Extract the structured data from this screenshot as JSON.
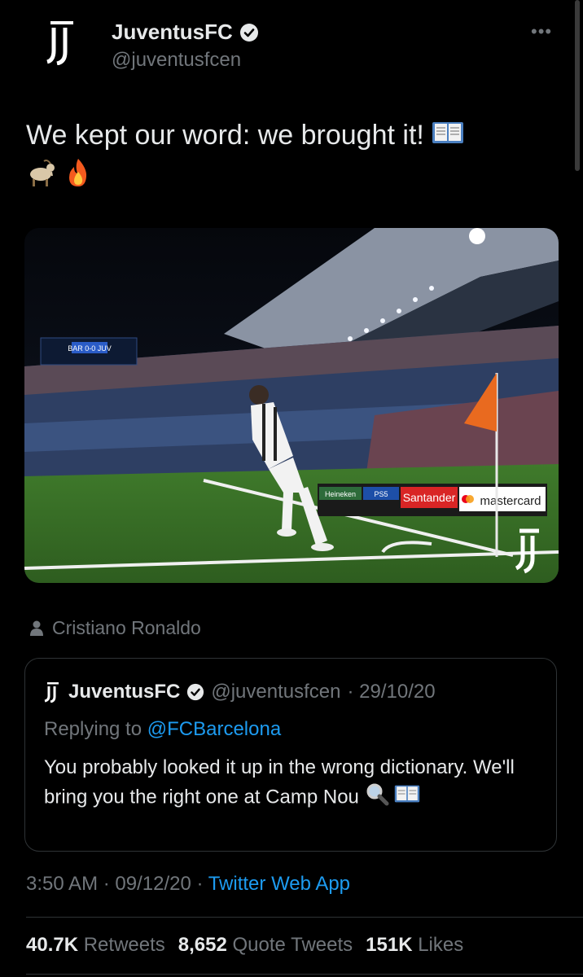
{
  "header": {
    "display_name": "JuventusFC",
    "handle": "@juventusfcen",
    "more_label": "•••"
  },
  "tweet": {
    "text": "We kept our word: we brought it!",
    "emojis": [
      "open-book",
      "goat",
      "fire"
    ],
    "photo": {
      "scoreboard": "BAR 0-0 JUV",
      "sponsor_1": "Santander",
      "sponsor_2": "mastercard",
      "sponsor_3": "Heineken",
      "sponsor_4": "PS5"
    },
    "tagged_user": "Cristiano Ronaldo"
  },
  "quoted": {
    "display_name": "JuventusFC",
    "handle": "@juventusfcen",
    "date": "· 29/10/20",
    "replying_prefix": "Replying to",
    "replying_to": "@FCBarcelona",
    "text": "You probably looked it up in the wrong dictionary. We'll bring you the right one at Camp Nou"
  },
  "meta": {
    "time": "3:50 AM",
    "date": "· 09/12/20 ·",
    "source": "Twitter Web App"
  },
  "stats": {
    "retweets_count": "40.7K",
    "retweets_label": "Retweets",
    "quotes_count": "8,652",
    "quotes_label": "Quote Tweets",
    "likes_count": "151K",
    "likes_label": "Likes"
  },
  "colors": {
    "background": "#000000",
    "text": "#e7e9ea",
    "secondary": "#71767b",
    "link": "#1d9bf0",
    "border": "#2f3336"
  }
}
